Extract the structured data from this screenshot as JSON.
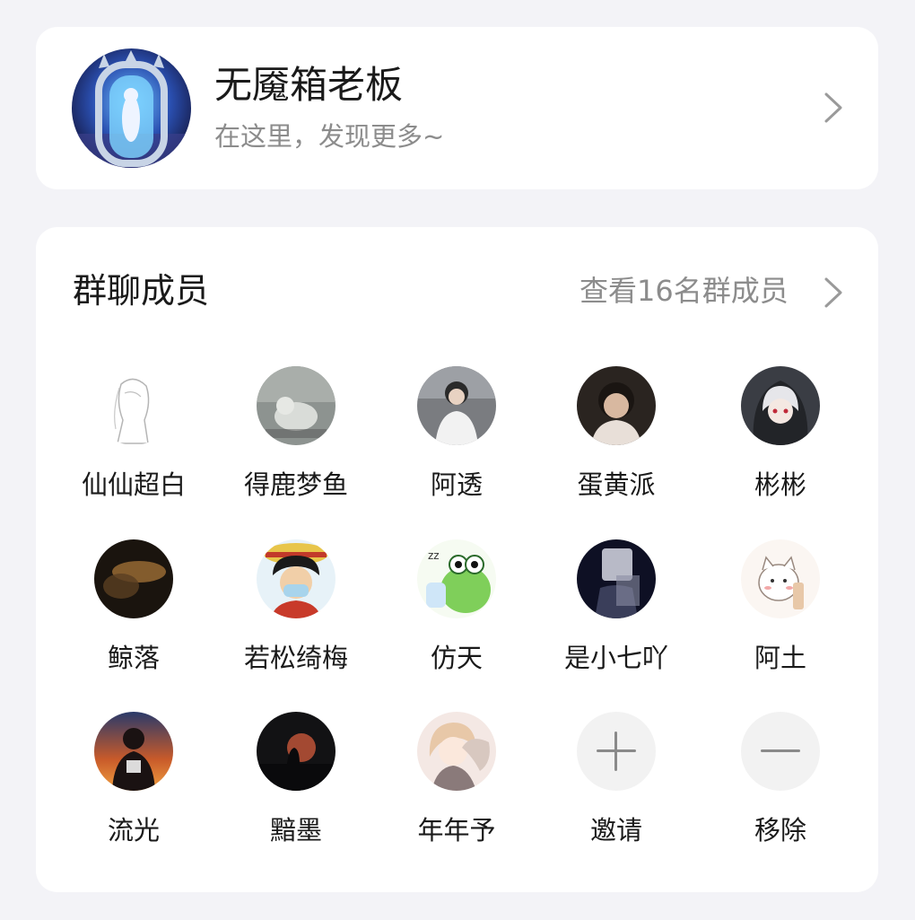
{
  "profile": {
    "name": "无魇箱老板",
    "subtitle": "在这里，发现更多~"
  },
  "members_section": {
    "title": "群聊成员",
    "view_all": "查看16名群成员"
  },
  "members": [
    {
      "name": "仙仙超白"
    },
    {
      "name": "得鹿梦鱼"
    },
    {
      "name": "阿透"
    },
    {
      "name": "蛋黄派"
    },
    {
      "name": "彬彬"
    },
    {
      "name": "鲸落"
    },
    {
      "name": "若松绮梅"
    },
    {
      "name": "仿天"
    },
    {
      "name": "是小七吖"
    },
    {
      "name": "阿土"
    },
    {
      "name": "流光"
    },
    {
      "name": "黯墨"
    },
    {
      "name": "年年予"
    }
  ],
  "actions": {
    "invite": "邀请",
    "remove": "移除"
  }
}
